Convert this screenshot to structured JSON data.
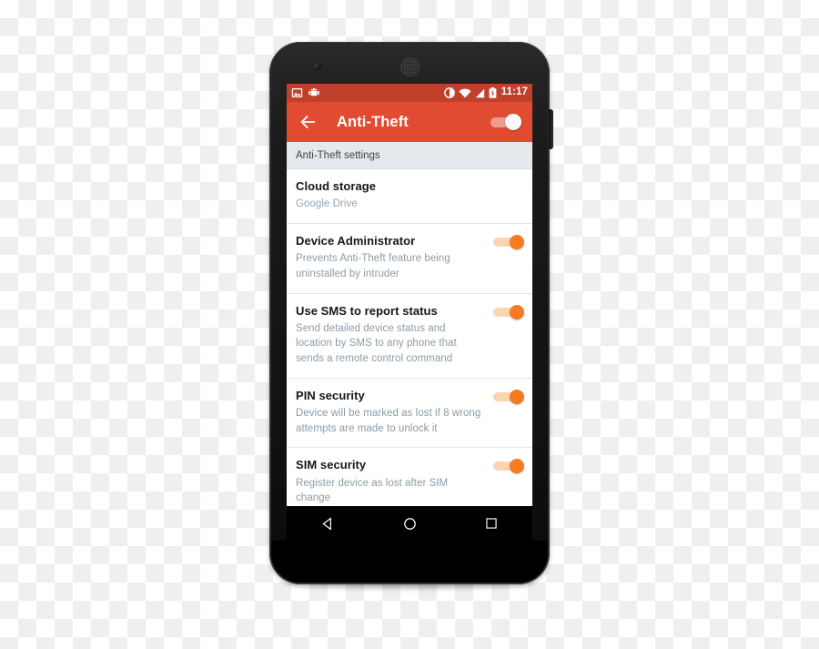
{
  "device": {
    "name": "android-phone-mockup",
    "earpiece": "speaker-grille",
    "camera": "front-camera"
  },
  "status_bar": {
    "background": "#c0402b",
    "left_icons": [
      "screenshot-icon",
      "android-robot-icon"
    ],
    "right_icons": [
      "do-not-disturb-icon",
      "wifi-icon",
      "cellular-signal-icon",
      "battery-icon"
    ],
    "time": "11:17"
  },
  "app_bar": {
    "background": "#e04b32",
    "back_label": "back-arrow",
    "title": "Anti-Theft",
    "master_switch": {
      "label": "anti-theft-master-toggle",
      "state": "on"
    }
  },
  "section": {
    "header": "Anti-Theft settings",
    "background": "#e3e9ec"
  },
  "accent": {
    "switch_on": "#f57c20",
    "switch_track": "#fbd4b0",
    "primary_red": "#e04b32",
    "status_red": "#c0402b"
  },
  "settings": [
    {
      "title": "Cloud storage",
      "subtitle": "Google Drive",
      "has_switch": false,
      "switch_state": null
    },
    {
      "title": "Device Administrator",
      "subtitle": "Prevents Anti-Theft feature being uninstalled by intruder",
      "has_switch": true,
      "switch_state": "on"
    },
    {
      "title": "Use SMS to report status",
      "subtitle": "Send detailed device status and location by SMS to any phone that sends a remote control command",
      "has_switch": true,
      "switch_state": "on"
    },
    {
      "title": "PIN security",
      "subtitle": "Device will be marked as lost if 8 wrong attempts are made to unlock it",
      "has_switch": true,
      "switch_state": "on"
    },
    {
      "title": "SIM security",
      "subtitle": "Register device as lost after SIM change",
      "has_switch": true,
      "switch_state": "on"
    }
  ],
  "nav_bar": {
    "buttons": [
      "back-nav-icon",
      "home-nav-icon",
      "recents-nav-icon"
    ]
  }
}
